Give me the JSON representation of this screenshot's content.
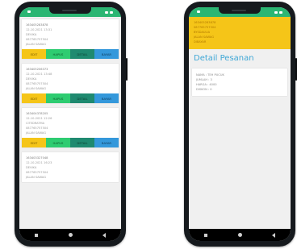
{
  "colors": {
    "status_bar": "#2bb673",
    "edit": "#f5c518",
    "hapus": "#2ecc71",
    "detail": "#1f8a70",
    "bayar": "#3498db",
    "header": "#f5c518",
    "title": "#3fa7d6"
  },
  "left_screen": {
    "orders": [
      {
        "id": "163405283878",
        "datetime": "12-10-2021 13:31",
        "name": "DEVIKA",
        "phone": "087765757504",
        "address": "JALAN SAWAG",
        "buttons": {
          "edit": "EDIT",
          "hapus": "HAPUS",
          "detail": "DETAIL",
          "bayar": "BAYAR"
        }
      },
      {
        "id": "163405206373",
        "datetime": "12-10-2021 13:48",
        "name": "DEVIKA",
        "phone": "087765757504",
        "address": "JALAN SAWAG",
        "buttons": {
          "edit": "EDIT",
          "hapus": "HAPUS",
          "detail": "DETAIL",
          "bayar": "BAYAR"
        }
      },
      {
        "id": "163404378205",
        "datetime": "12-10-2021 12:26",
        "name": "CITEDRATMA",
        "phone": "087765757504",
        "address": "JALAN SAWAG",
        "buttons": {
          "edit": "EDIT",
          "hapus": "HAPUS",
          "detail": "DETAIL",
          "bayar": "BAYAR"
        }
      },
      {
        "id": "163403327048",
        "datetime": "12-10-2021 16:23",
        "name": "DEVIKA",
        "phone": "087765757504",
        "address": "JALAN SAWAG"
      }
    ]
  },
  "right_screen": {
    "header": {
      "id": "163405283878",
      "phone": "087765757504",
      "name": "BYSDAULIA",
      "address": "JALAN SAWAG",
      "status": "DIBAYAR"
    },
    "title": "Detail Pesanan",
    "item": {
      "name": "NAMA : TEH PUCUK",
      "qty": "JUMLAH : 3",
      "price": "HARGA : 4000",
      "discount": "DISKON : 0"
    }
  }
}
